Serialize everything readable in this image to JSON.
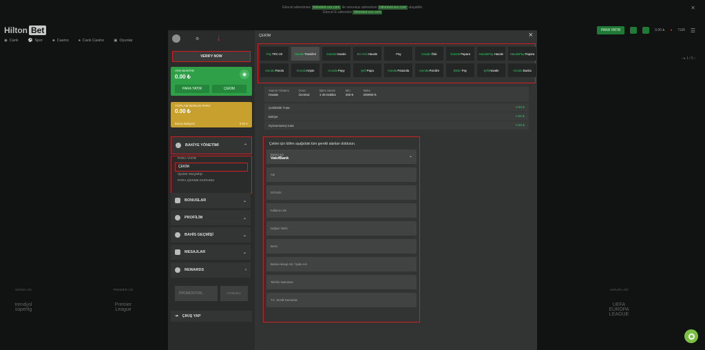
{
  "topnote": {
    "line1": "Güncel adresimize",
    "link1": "hiltonbet-xxx.com",
    "mid": "ile sorunsuz adresinize",
    "link2": "hiltonbet-xxx.com",
    "end": "ulaşabilir.",
    "line2": "Güncel E-adresiniz",
    "link3": "hiltonbet-xxx.com"
  },
  "brand": {
    "name": "Hilton",
    "badge": "Bet"
  },
  "nav": [
    "Canlı",
    "Spor",
    "Casino",
    "Canlı Casino",
    "Oyunlar"
  ],
  "header": {
    "deposit_button": "PARA YATIR",
    "balance": "0.00 ₺",
    "lang": "TUR"
  },
  "pager": "‹ ▸ 1 / 5 ›",
  "leagues": [
    {
      "tag": "SÜPER LİG",
      "name": "trendyol süperlig"
    },
    {
      "tag": "PREMIER LİG",
      "name": "Premier League"
    },
    {
      "tag": "AVRUPA LİGİ",
      "name": "UEFA EUROPA LEAGUE"
    }
  ],
  "left": {
    "verify": "VERIFY NOW",
    "balance_label": "ANA BAKİYE",
    "balance_amount": "0.00 ₺",
    "deposit": "PARA YATIR",
    "withdraw": "ÇEKİM",
    "bonus_label": "TOPLAM BONUS PARA",
    "bonus_amount": "0.00 ₺",
    "bonus_row_label": "Bonus Bakiyesi",
    "bonus_row_value": "0.00 ₺",
    "bakiye_title": "BAKİYE YÖNETİMİ",
    "sub": [
      "PARA YATIR",
      "ÇEKİM",
      "İŞLEM GEÇMİŞİ",
      "PARA ÇEKME DURUMU"
    ],
    "menus": [
      "BONUSLAR",
      "PROFİLİM",
      "BAHİS GEÇMİŞİ",
      "MESAJLAR",
      "REWARDS"
    ],
    "promo_placeholder": "PROMOSYON...",
    "apply": "UYGULA",
    "logout": "ÇIKIŞ YAP"
  },
  "right": {
    "title": "ÇEKİM",
    "methods": [
      {
        "g": "Pay",
        "w": "TRC-20"
      },
      {
        "g": "Havale",
        "w": "Transferi",
        "sel": true
      },
      {
        "g": "Garanti",
        "w": "Havale"
      },
      {
        "g": "En Hızlı",
        "w": "Havale"
      },
      {
        "g": "",
        "w": "Pay"
      },
      {
        "g": "Havale",
        "w": "Öde"
      },
      {
        "g": "Garanti",
        "w": "Papara"
      },
      {
        "g": "HavalePay",
        "w": "Havale"
      },
      {
        "g": "HavalePay",
        "w": "Papara"
      },
      {
        "g": "Anında",
        "w": "Parola"
      },
      {
        "g": "Anında",
        "w": "Kripto"
      },
      {
        "g": "Anında",
        "w": "Pepy"
      },
      {
        "g": "Şeft",
        "w": "Papa"
      },
      {
        "g": "Anında",
        "w": "Parazula"
      },
      {
        "g": "Anında",
        "w": "Parolim"
      },
      {
        "g": "Birsin",
        "w": "Pay"
      },
      {
        "g": "Şeft",
        "w": "Havale"
      },
      {
        "g": "Anında",
        "w": "Banka"
      }
    ],
    "info": [
      {
        "k": "Yatırım Yöntemi",
        "v": "Havale"
      },
      {
        "k": "Ücret",
        "v": "Ücretsiz"
      },
      {
        "k": "İşlem Süresi",
        "v": "1-45 Dakika"
      },
      {
        "k": "Min.",
        "v": "200 ₺"
      },
      {
        "k": "Maks.",
        "v": "200000 ₺"
      }
    ],
    "rows": [
      {
        "k": "Çekilebilir Tutar",
        "v": "0.00 ₺"
      },
      {
        "k": "Bakiye",
        "v": "0.00 ₺"
      },
      {
        "k": "Oynanmamış tutar",
        "v": "0.00 ₺"
      }
    ],
    "form_heading": "Çekim için lütfen aşağıdaki tüm gerekli alanları doldurun.",
    "bank_label": "Banka adı",
    "bank_value": "VakıfBank",
    "fields": [
      "Adı",
      "SOYADI",
      "Kullanıcı adı",
      "Doğum Tarihi",
      "IBAN",
      "Banka Hesap Adı / Şube Adı",
      "Telefon Numarası",
      "T.C. Kimlik Numarası"
    ]
  }
}
